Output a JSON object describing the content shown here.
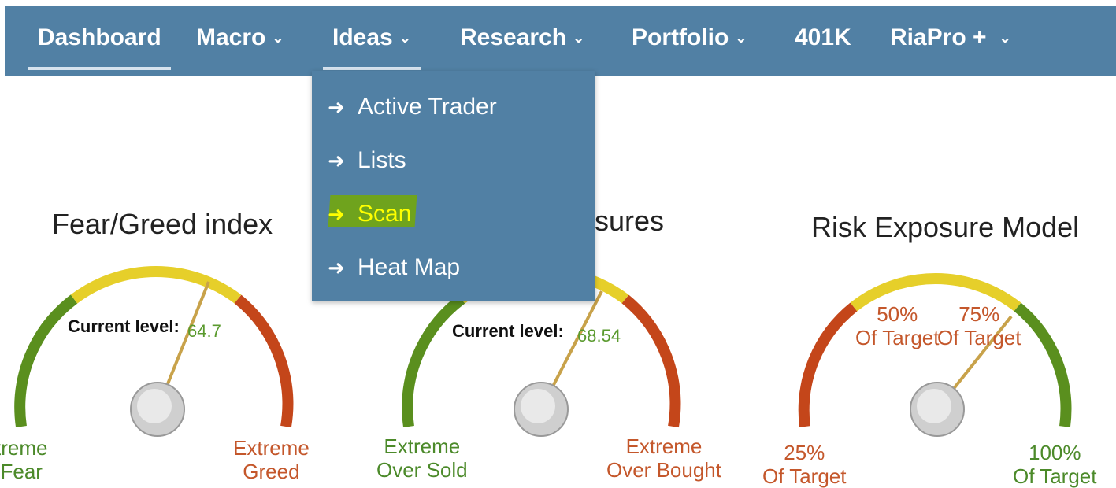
{
  "nav": {
    "items": [
      {
        "label": "Dashboard",
        "chevron": false
      },
      {
        "label": "Macro",
        "chevron": true
      },
      {
        "label": "Ideas",
        "chevron": true
      },
      {
        "label": "Research",
        "chevron": true
      },
      {
        "label": "Portfolio",
        "chevron": true
      },
      {
        "label": "401K",
        "chevron": false
      },
      {
        "label": "RiaPro +",
        "chevron": true
      }
    ],
    "chevron_glyph": "⌄",
    "active": "Dashboard",
    "open_menu": "Ideas"
  },
  "dropdown": {
    "icon": "sign-in-arrow-icon",
    "icon_glyph": "➜",
    "items": [
      {
        "label": "Active Trader"
      },
      {
        "label": "Lists"
      },
      {
        "label": "Scan",
        "highlighted": true
      },
      {
        "label": "Heat Map"
      }
    ]
  },
  "gauges": [
    {
      "title": "Fear/Greed index",
      "current_label": "Current level:",
      "current_value": "64.7",
      "left_label": "treme\nFear",
      "right_label": "Extreme\nGreed"
    },
    {
      "title": "sures",
      "current_label": "Current level:",
      "current_value": "68.54",
      "left_label": "Extreme\nOver Sold",
      "right_label": "Extreme\nOver Bought"
    },
    {
      "title": "Risk Exposure Model",
      "label_50": "50%\nOf Target",
      "label_75": "75%\nOf Target",
      "left_label": "25%\nOf Target",
      "right_label": "100%\nOf Target"
    }
  ],
  "colors": {
    "navbar": "#5180a4",
    "green": "#5a8f1e",
    "yellow": "#e6cf2a",
    "red": "#c4461a",
    "highlight": "#6fa31d"
  }
}
